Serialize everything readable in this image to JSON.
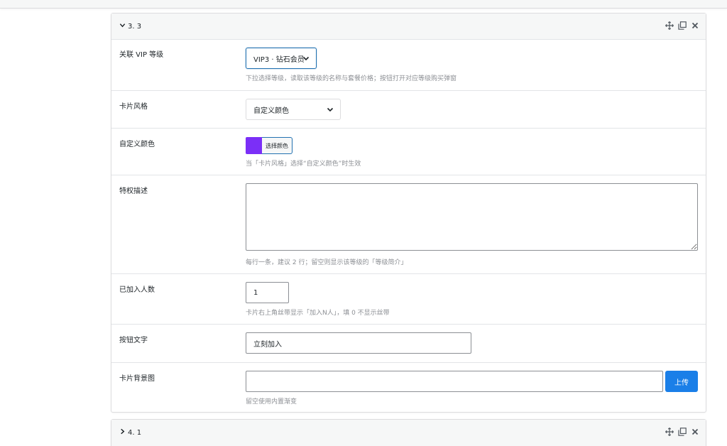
{
  "panels": [
    {
      "title": "3. 3",
      "expanded": true,
      "fields": {
        "vip_level": {
          "label": "关联 VIP 等级",
          "selected": "VIP3 · 钻石会员",
          "help": "下拉选择等级，读取该等级的名称与套餐价格；按钮打开对应等级购买弹窗"
        },
        "card_style": {
          "label": "卡片风格",
          "selected": "自定义颜色"
        },
        "custom_color": {
          "label": "自定义颜色",
          "color": "#7b2ff7",
          "button_label": "选择颜色",
          "help": "当「卡片风格」选择“自定义颜色”时生效"
        },
        "privilege_desc": {
          "label": "特权描述",
          "value": "",
          "help": "每行一条，建议 2 行；留空则显示该等级的「等级简介」"
        },
        "joined_count": {
          "label": "已加入人数",
          "value": "1",
          "help": "卡片右上角丝带显示「加入N人」，填 0 不显示丝带"
        },
        "button_text": {
          "label": "按钮文字",
          "value": "立刻加入"
        },
        "card_bg": {
          "label": "卡片背景图",
          "value": "",
          "upload_label": "上传",
          "help": "留空使用内置渐变"
        }
      }
    },
    {
      "title": "4. 1",
      "expanded": false
    }
  ],
  "icons": {
    "move": "move-icon",
    "duplicate": "duplicate-icon",
    "close": "close-icon"
  },
  "colors": {
    "accent": "#2271b1",
    "upload_button": "#1a7fe8",
    "swatch": "#7b2ff7"
  }
}
